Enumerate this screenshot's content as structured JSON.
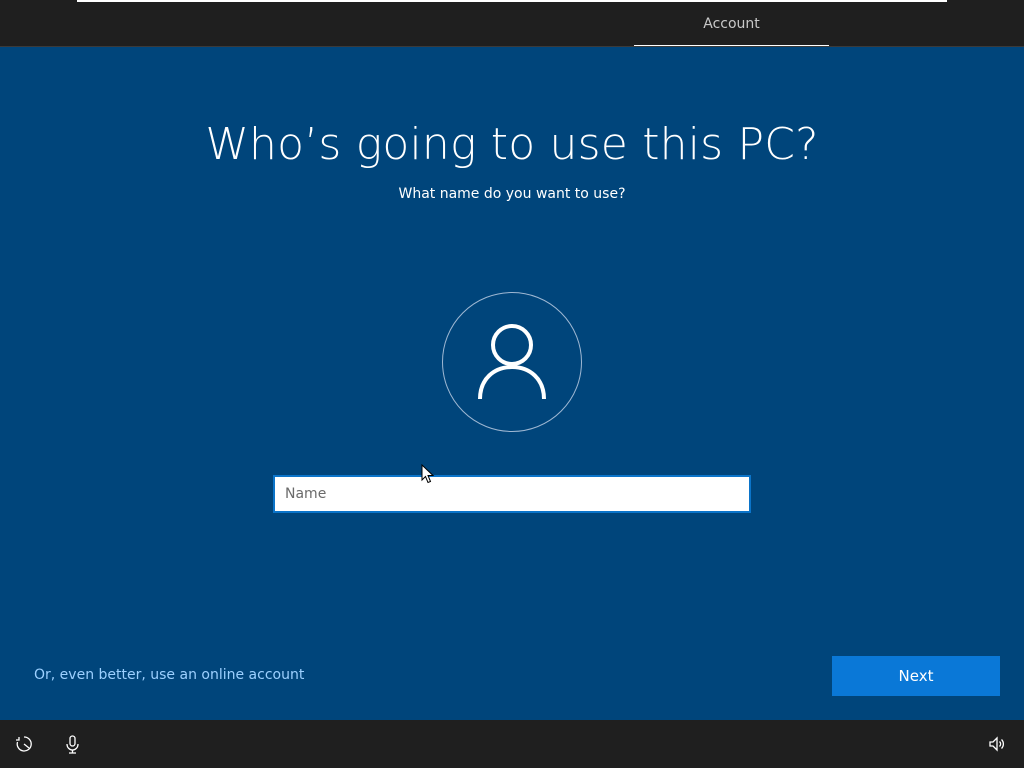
{
  "topbar": {
    "active_tab": "Account"
  },
  "main": {
    "title": "Who’s going to use this PC?",
    "subtitle": "What name do you want to use?",
    "avatar_icon": "user-icon",
    "name_input": {
      "placeholder": "Name",
      "value": ""
    },
    "online_account_link": "Or, even better, use an online account",
    "next_button": "Next"
  },
  "bottombar": {
    "icons": [
      "ease-of-access-icon",
      "microphone-icon",
      "volume-icon"
    ]
  },
  "colors": {
    "background": "#00457b",
    "bars": "#1f1f1f",
    "accent": "#0a78d7",
    "link": "#9cd0ff"
  }
}
